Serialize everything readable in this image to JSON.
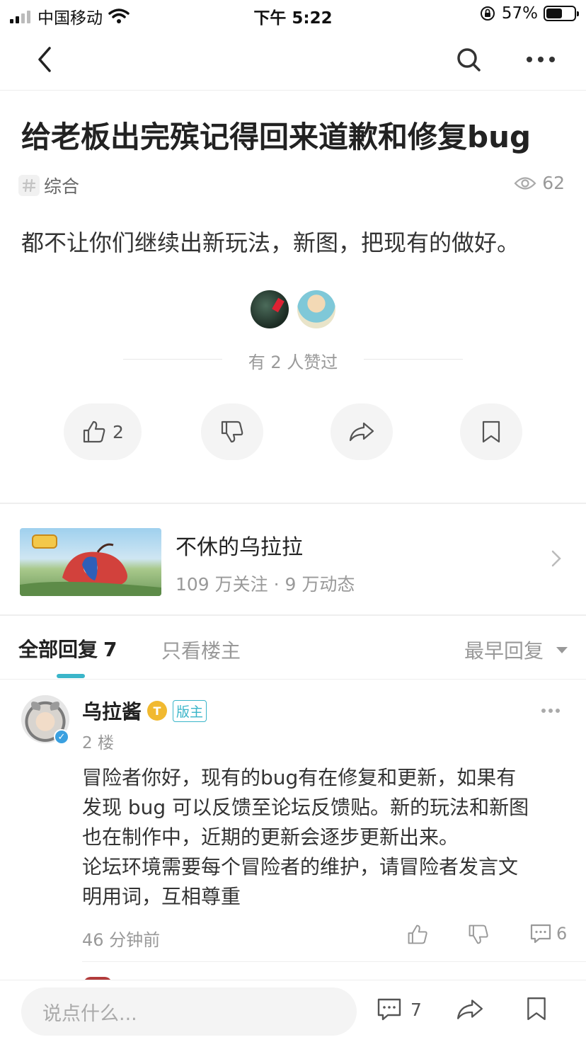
{
  "status_bar": {
    "carrier": "中国移动",
    "time": "下午 5:22",
    "battery": "57%",
    "battery_level": 0.57
  },
  "post": {
    "title": "给老板出完殡记得回来道歉和修复bug",
    "tag": "综合",
    "views": "62",
    "body": "都不让你们继续出新玩法，新图，把现有的做好。",
    "likes_summary": "有 2 人赞过",
    "like_count": "2"
  },
  "game": {
    "name": "不休的乌拉拉",
    "stats": "109 万关注 · 9 万动态"
  },
  "tabs": {
    "all_label": "全部回复",
    "all_count": "7",
    "op_only_label": "只看楼主",
    "sort_label": "最早回复"
  },
  "reply": {
    "username": "乌拉酱",
    "level_badge": "T",
    "role_badge": "版主",
    "floor": "2 楼",
    "lines": [
      "冒险者你好，现有的bug有在修复和更新，如果有",
      "发现 bug 可以反馈至论坛反馈贴。新的玩法和新图",
      "也在制作中，近期的更新会逐步更新出来。",
      "论坛环境需要每个冒险者的维护，请冒险者发言文",
      "明用词，互相尊重"
    ],
    "time": "46 分钟前",
    "comment_count": "6"
  },
  "bottom_bar": {
    "input_placeholder": "说点什么...",
    "comment_count": "7"
  },
  "icons": [
    "back-icon",
    "search-icon",
    "more-icon",
    "hash-icon",
    "eye-icon",
    "thumb-up-icon",
    "thumb-down-icon",
    "share-icon",
    "bookmark-icon",
    "chevron-right-icon",
    "comment-icon",
    "verified-icon"
  ],
  "colors": {
    "accent": "#3ab5c9",
    "level_badge": "#f1b930",
    "verified": "#3aa0e0"
  }
}
